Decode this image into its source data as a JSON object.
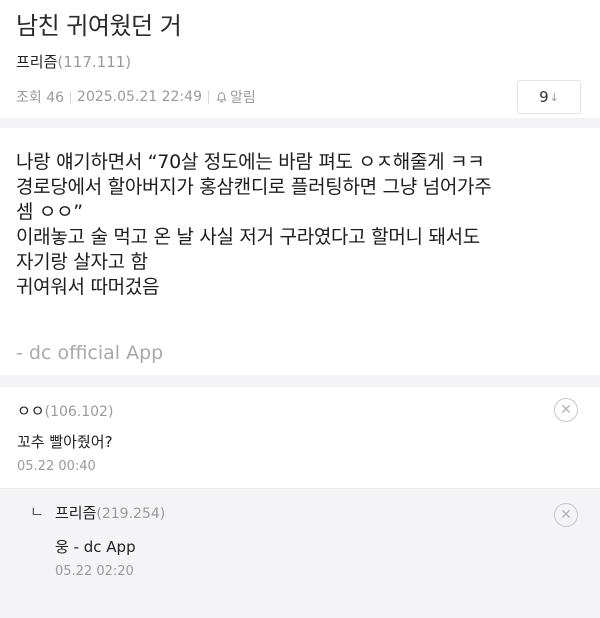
{
  "post": {
    "title": "남친 귀여웠던 거",
    "author": "프리즘",
    "author_ip": "(117.111)",
    "views_label": "조회 46",
    "date": "2025.05.21 22:49",
    "alarm_label": "알림",
    "reply_count": "9",
    "body_lines": [
      "나랑 얘기하면서 “70살 정도에는 바람 펴도 ㅇㅈ해줄게 ㅋㅋ",
      "경로당에서 할아버지가 홍삼캔디로 플러팅하면 그냥 넘어가주",
      "셈 ㅇㅇ”",
      "이래놓고 술 먹고 온 날 사실 저거 구라였다고 할머니 돼서도",
      "자기랑 살자고 함",
      "귀여워서 따머겄음"
    ],
    "source": "- dc official App"
  },
  "comments": [
    {
      "nick": "ㅇㅇ",
      "ip": "(106.102)",
      "text": "꼬추 빨아줬어?",
      "date": "05.22 00:40"
    }
  ],
  "replies": [
    {
      "arrow": "ㄴ",
      "nick": "프리즘",
      "ip": "(219.254)",
      "text": "웅 - dc App",
      "date": "05.22 02:20"
    }
  ],
  "icons": {
    "alarm": "bell-icon",
    "delete": "circle-x-icon",
    "reply_arrow": "arrow-down-icon"
  }
}
